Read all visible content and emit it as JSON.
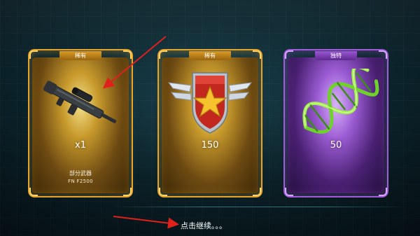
{
  "rewards": [
    {
      "rarity": "稀有",
      "quantity": "x1",
      "name": "部分武器",
      "subname": "FN F2500",
      "icon": "assault-rifle-icon",
      "theme": "#e6a52a"
    },
    {
      "rarity": "稀有",
      "quantity": "150",
      "icon": "star-rank-badge-icon",
      "theme": "#e6a52a"
    },
    {
      "rarity": "独特",
      "quantity": "50",
      "icon": "dna-helix-icon",
      "theme": "#a25bdc"
    }
  ],
  "footer": {
    "continue_label": "点击继续。。。"
  },
  "annotations": {
    "arrow_color": "#e0201c"
  },
  "colors": {
    "gold": "#e6a52a",
    "purple": "#a25bdc",
    "background": "#0e2a33"
  }
}
